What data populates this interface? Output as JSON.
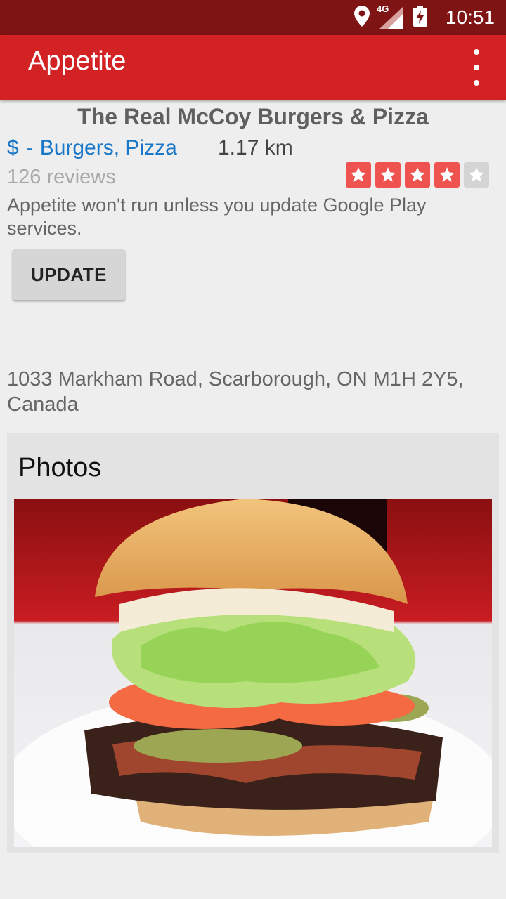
{
  "status_bar": {
    "time": "10:51",
    "network": "4G",
    "icons": [
      "location-icon",
      "signal-icon",
      "battery-charging-icon"
    ]
  },
  "app_bar": {
    "title": "Appetite",
    "menu_icon": "overflow-menu-icon"
  },
  "restaurant": {
    "name": "The Real McCoy Burgers & Pizza",
    "price": "$",
    "separator": "-",
    "categories": "Burgers, Pizza",
    "distance": "1.17 km",
    "reviews": "126 reviews",
    "rating": 4,
    "rating_max": 5,
    "address": "1033 Markham Road, Scarborough, ON M1H 2Y5, Canada"
  },
  "play_services": {
    "message": "Appetite won't run unless you update Google Play services.",
    "button_label": "UPDATE"
  },
  "photos": {
    "title": "Photos",
    "items": [
      {
        "icon": "burger-photo"
      }
    ]
  },
  "colors": {
    "status_bar": "#7f1414",
    "app_bar": "#d32224",
    "link": "#1b78c8",
    "star_on": "#ee5350",
    "star_off": "#d4d4d4"
  }
}
